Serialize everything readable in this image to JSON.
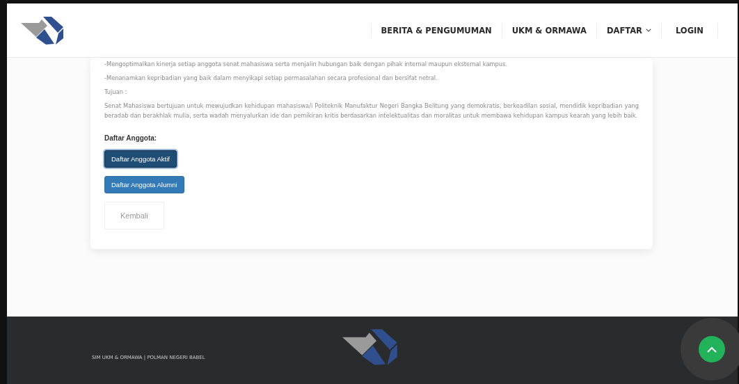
{
  "nav": {
    "items": [
      {
        "label": "BERITA & PENGUMUMAN",
        "dropdown": false
      },
      {
        "label": "UKM & ORMAWA",
        "dropdown": false
      },
      {
        "label": "DAFTAR",
        "dropdown": true
      },
      {
        "label": "LOGIN",
        "dropdown": false
      }
    ]
  },
  "content": {
    "paragraphs": [
      "-Mengoptimalkan kinerja setiap anggota senat mahasiswa serta menjalin hubungan baik dengan pihak internal maupun eksternal kampus.",
      "-Menanamkan kepribadian yang baik dalam menyikapi setiap permasalahan secara profesional dan bersifat netral.",
      "Tujuan :",
      "Senat Mahasiswa bertujuan untuk mewujudkan kehidupan mahasiswa/i Politeknik Manufaktur Negeri Bangka Belitung yang demokratis, berkeadilan sosial, mendidik kepribadian yang beradab dan berakhlak mulia, serta wadah menyalurkan ide dan pemikiran kritis berdasarkan intelektualitas dan moralitas untuk membawa kehidupan kampus kearah yang lebih baik."
    ],
    "members_heading": "Daftar Anggota:",
    "member_buttons": [
      {
        "label": "Daftar Anggota Aktif",
        "selected": true
      },
      {
        "label": "Daftar Anggota Alumni",
        "selected": false
      }
    ],
    "back_button": "Kembali"
  },
  "footer": {
    "text": "SIM UKM & ORMAWA | POLMAN NEGERI BABEL"
  }
}
